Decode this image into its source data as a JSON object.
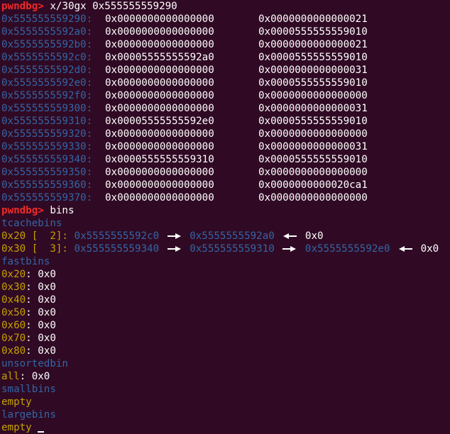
{
  "terminal": {
    "prompt": "pwndbg>",
    "command1": "x/30gx 0x555555559290",
    "command2": "bins",
    "memory_dump": [
      {
        "addr": "0x555555559290:",
        "v1": "0x0000000000000000",
        "v2": "0x0000000000000021"
      },
      {
        "addr": "0x5555555592a0:",
        "v1": "0x0000000000000000",
        "v2": "0x0000555555559010"
      },
      {
        "addr": "0x5555555592b0:",
        "v1": "0x0000000000000000",
        "v2": "0x0000000000000021"
      },
      {
        "addr": "0x5555555592c0:",
        "v1": "0x00005555555592a0",
        "v2": "0x0000555555559010"
      },
      {
        "addr": "0x5555555592d0:",
        "v1": "0x0000000000000000",
        "v2": "0x0000000000000031"
      },
      {
        "addr": "0x5555555592e0:",
        "v1": "0x0000000000000000",
        "v2": "0x0000555555559010"
      },
      {
        "addr": "0x5555555592f0:",
        "v1": "0x0000000000000000",
        "v2": "0x0000000000000000"
      },
      {
        "addr": "0x555555559300:",
        "v1": "0x0000000000000000",
        "v2": "0x0000000000000031"
      },
      {
        "addr": "0x555555559310:",
        "v1": "0x00005555555592e0",
        "v2": "0x0000555555559010"
      },
      {
        "addr": "0x555555559320:",
        "v1": "0x0000000000000000",
        "v2": "0x0000000000000000"
      },
      {
        "addr": "0x555555559330:",
        "v1": "0x0000000000000000",
        "v2": "0x0000000000000031"
      },
      {
        "addr": "0x555555559340:",
        "v1": "0x0000555555559310",
        "v2": "0x0000555555559010"
      },
      {
        "addr": "0x555555559350:",
        "v1": "0x0000000000000000",
        "v2": "0x0000000000000000"
      },
      {
        "addr": "0x555555559360:",
        "v1": "0x0000000000000000",
        "v2": "0x0000000000020ca1"
      },
      {
        "addr": "0x555555559370:",
        "v1": "0x0000000000000000",
        "v2": "0x0000000000000000"
      }
    ],
    "tcachebins": {
      "title": "tcachebins",
      "rows": [
        {
          "size": "0x20",
          "bracket_open": " [",
          "count": "  2",
          "bracket_close": "]:",
          "chain": [
            "0x5555555592c0",
            "0x5555555592a0"
          ],
          "end": "0x0"
        },
        {
          "size": "0x30",
          "bracket_open": " [",
          "count": "  3",
          "bracket_close": "]:",
          "chain": [
            "0x555555559340",
            "0x555555559310",
            "0x5555555592e0"
          ],
          "end": "0x0"
        }
      ]
    },
    "fastbins": {
      "title": "fastbins",
      "rows": [
        {
          "size": "0x20",
          "value": "0x0"
        },
        {
          "size": "0x30",
          "value": "0x0"
        },
        {
          "size": "0x40",
          "value": "0x0"
        },
        {
          "size": "0x50",
          "value": "0x0"
        },
        {
          "size": "0x60",
          "value": "0x0"
        },
        {
          "size": "0x70",
          "value": "0x0"
        },
        {
          "size": "0x80",
          "value": "0x0"
        }
      ]
    },
    "unsortedbin": {
      "title": "unsortedbin",
      "label": "all",
      "value": "0x0"
    },
    "smallbins": {
      "title": "smallbins",
      "value": "empty"
    },
    "largebins": {
      "title": "largebins",
      "value": "empty"
    },
    "colors": {
      "background": "#300a24",
      "prompt": "#ef2929",
      "address": "#3465a4",
      "size": "#c4a000",
      "text": "#ffffff"
    }
  }
}
